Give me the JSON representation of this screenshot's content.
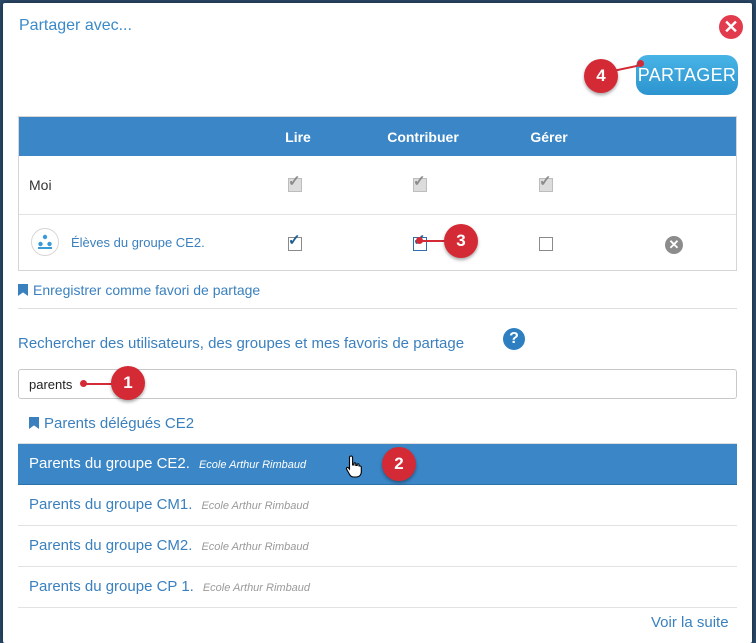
{
  "dialog": {
    "title": "Partager avec...",
    "close_icon": "close-icon",
    "share_button": "PARTAGER"
  },
  "table": {
    "headers": [
      "",
      "Lire",
      "Contribuer",
      "Gérer",
      ""
    ],
    "rows": [
      {
        "name": "Moi",
        "lire": true,
        "contribuer": true,
        "gerer": true,
        "disabled": true
      },
      {
        "name": "Élèves du groupe CE2.",
        "icon": "group-icon",
        "lire": true,
        "contribuer": true,
        "gerer": false,
        "removable": true
      }
    ]
  },
  "favorite_link": "Enregistrer comme favori de partage",
  "search": {
    "title": "Rechercher des utilisateurs, des groupes et mes favoris de partage",
    "value": "parents"
  },
  "results": {
    "favorite": "Parents délégués CE2",
    "items": [
      {
        "name": "Parents du groupe CE2.",
        "school": "Ecole Arthur Rimbaud",
        "selected": true
      },
      {
        "name": "Parents du groupe CM1.",
        "school": "Ecole Arthur Rimbaud",
        "selected": false
      },
      {
        "name": "Parents du groupe CM2.",
        "school": "Ecole Arthur Rimbaud",
        "selected": false
      },
      {
        "name": "Parents du groupe CP 1.",
        "school": "Ecole Arthur Rimbaud",
        "selected": false
      }
    ],
    "more": "Voir la suite"
  },
  "annotations": [
    "1",
    "2",
    "3",
    "4"
  ],
  "colors": {
    "header_blue": "#3a86c6",
    "link_blue": "#3a80be",
    "annotation_red": "#d42a35",
    "close_red": "#e23b4e"
  }
}
